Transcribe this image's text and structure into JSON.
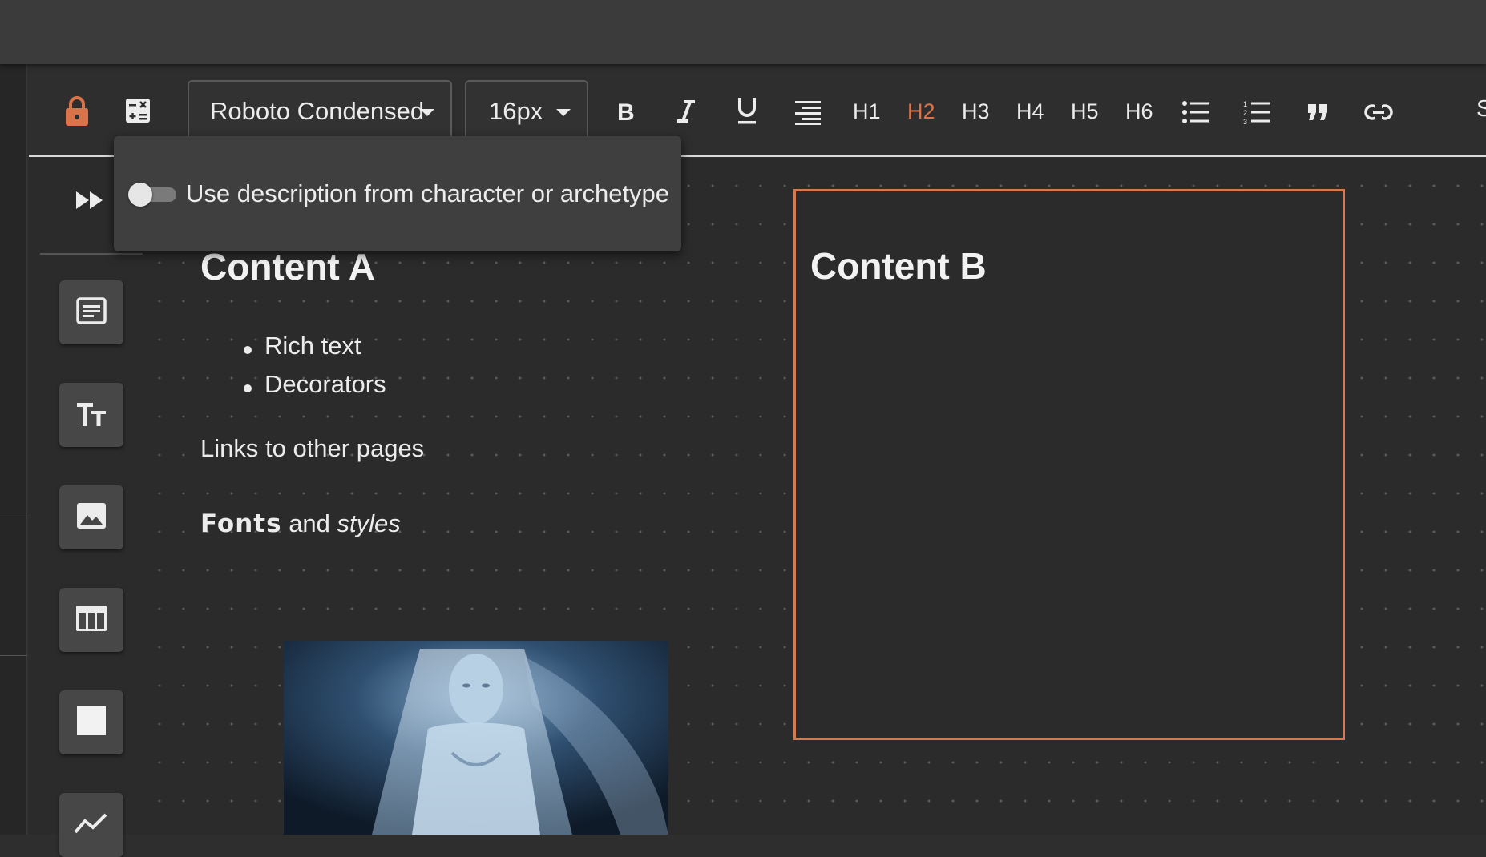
{
  "toolbar": {
    "font_family": "Roboto Condensed",
    "font_size": "16px",
    "headings": [
      "H1",
      "H2",
      "H3",
      "H4",
      "H5",
      "H6"
    ],
    "active_heading": "H2",
    "cutoff_label": "S",
    "accent_color": "#d9744a"
  },
  "popover": {
    "toggle_label": "Use description from character or archetype",
    "toggle_on": false
  },
  "content_a": {
    "title": "Content A",
    "bullets": [
      "Rich text",
      "Decorators"
    ],
    "links_text": "Links to other pages",
    "fonts_word": "Fonts",
    "and_word": "and",
    "styles_word": "styles"
  },
  "content_b": {
    "title": "Content B"
  },
  "sidebar": {
    "icons": [
      "text-block-icon",
      "text-size-icon",
      "image-icon",
      "table-icon",
      "square-icon",
      "line-chart-icon"
    ]
  }
}
